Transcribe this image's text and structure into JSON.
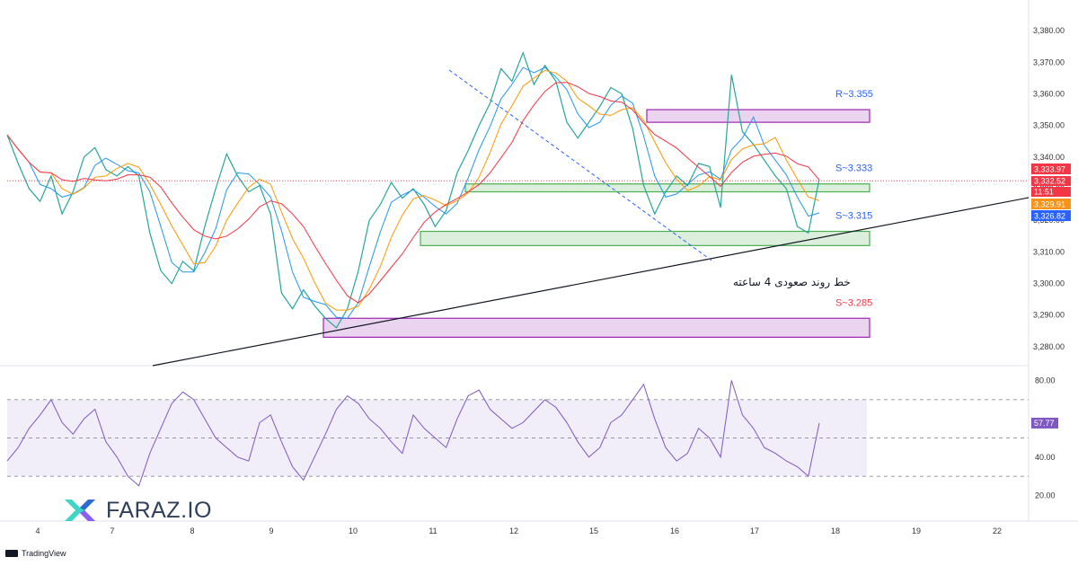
{
  "brand": {
    "name": "FARAZ.IO",
    "icon": "faraz-logo-icon",
    "colors": [
      "#3dd6c6",
      "#2d6bd0",
      "#8b5cf6"
    ]
  },
  "footer": {
    "tradingview_label": "TradingView",
    "icon": "tradingview-logo-icon"
  },
  "chart_data": [
    {
      "type": "line",
      "title": "",
      "xlabel": "",
      "ylabel": "",
      "x_ticks": [
        "4",
        "7",
        "8",
        "9",
        "10",
        "11",
        "12",
        "15",
        "16",
        "17",
        "18",
        "19",
        "22"
      ],
      "y_ticks": [
        "3,280.00",
        "3,290.00",
        "3,300.00",
        "3,310.00",
        "3,320.00",
        "3,330.00",
        "3,340.00",
        "3,350.00",
        "3,360.00",
        "3,370.00",
        "3,380.00"
      ],
      "ylim": [
        3276,
        3384
      ],
      "grid": false,
      "series": [
        {
          "values": [
            3347,
            3338,
            3330,
            3326,
            3334,
            3322,
            3329,
            3340,
            3343,
            3336,
            3334,
            3337,
            3334,
            3316,
            3304,
            3300,
            3307,
            3304,
            3318,
            3330,
            3341,
            3334,
            3329,
            3331,
            3322,
            3297,
            3292,
            3298,
            3293,
            3289,
            3286,
            3292,
            3304,
            3320,
            3325,
            3332,
            3327,
            3330,
            3325,
            3318,
            3323,
            3335,
            3342,
            3350,
            3357,
            3368,
            3364,
            3373,
            3363,
            3369,
            3364,
            3351,
            3346,
            3351,
            3356,
            3362,
            3360,
            3349,
            3331,
            3322,
            3329,
            3334,
            3331,
            3338,
            3337,
            3324,
            3366,
            3348,
            3344,
            3339,
            3334,
            3330,
            3318,
            3316,
            3333
          ]
        }
      ],
      "price_labels": [
        {
          "value": "3,333.97",
          "color": "#f23645"
        },
        {
          "value": "3,332.52",
          "color": "#f23645"
        },
        {
          "value": "11:51",
          "color": "#f23645"
        },
        {
          "value": "3,329.91",
          "color": "#f7931a"
        },
        {
          "value": "3,326.82",
          "color": "#2962ff"
        }
      ],
      "zones": [
        {
          "label": "R~3.355",
          "low": 3351,
          "high": 3355,
          "color": "#9c27b0",
          "label_color": "#2962ff"
        },
        {
          "label": "S~3.333",
          "low": 3329,
          "high": 3331.5,
          "color": "#4caf50",
          "label_color": "#2962ff"
        },
        {
          "label": "S~3.315",
          "low": 3312,
          "high": 3316.5,
          "color": "#4caf50",
          "label_color": "#2962ff"
        },
        {
          "label": "S~3.285",
          "low": 3283,
          "high": 3289,
          "color": "#9c27b0",
          "label_color": "#f23645"
        }
      ],
      "annotations": [
        {
          "text": "خط روند صعودی 4 ساعته"
        }
      ]
    },
    {
      "type": "line",
      "title": "",
      "y_ticks": [
        "20.00",
        "40.00",
        "80.00"
      ],
      "ylim": [
        16,
        84
      ],
      "band": [
        30,
        70
      ],
      "midline": 50,
      "last_value": "57.77",
      "series": [
        {
          "values": [
            38,
            45,
            55,
            62,
            70,
            58,
            52,
            60,
            65,
            48,
            40,
            30,
            25,
            42,
            55,
            68,
            74,
            70,
            60,
            50,
            45,
            40,
            38,
            58,
            62,
            48,
            35,
            28,
            40,
            52,
            65,
            72,
            68,
            60,
            55,
            48,
            42,
            62,
            55,
            50,
            45,
            60,
            72,
            75,
            65,
            60,
            55,
            58,
            64,
            70,
            66,
            58,
            48,
            40,
            45,
            58,
            62,
            70,
            78,
            60,
            45,
            38,
            42,
            55,
            50,
            40,
            80,
            62,
            55,
            45,
            42,
            38,
            35,
            30,
            57.77
          ]
        }
      ]
    }
  ]
}
